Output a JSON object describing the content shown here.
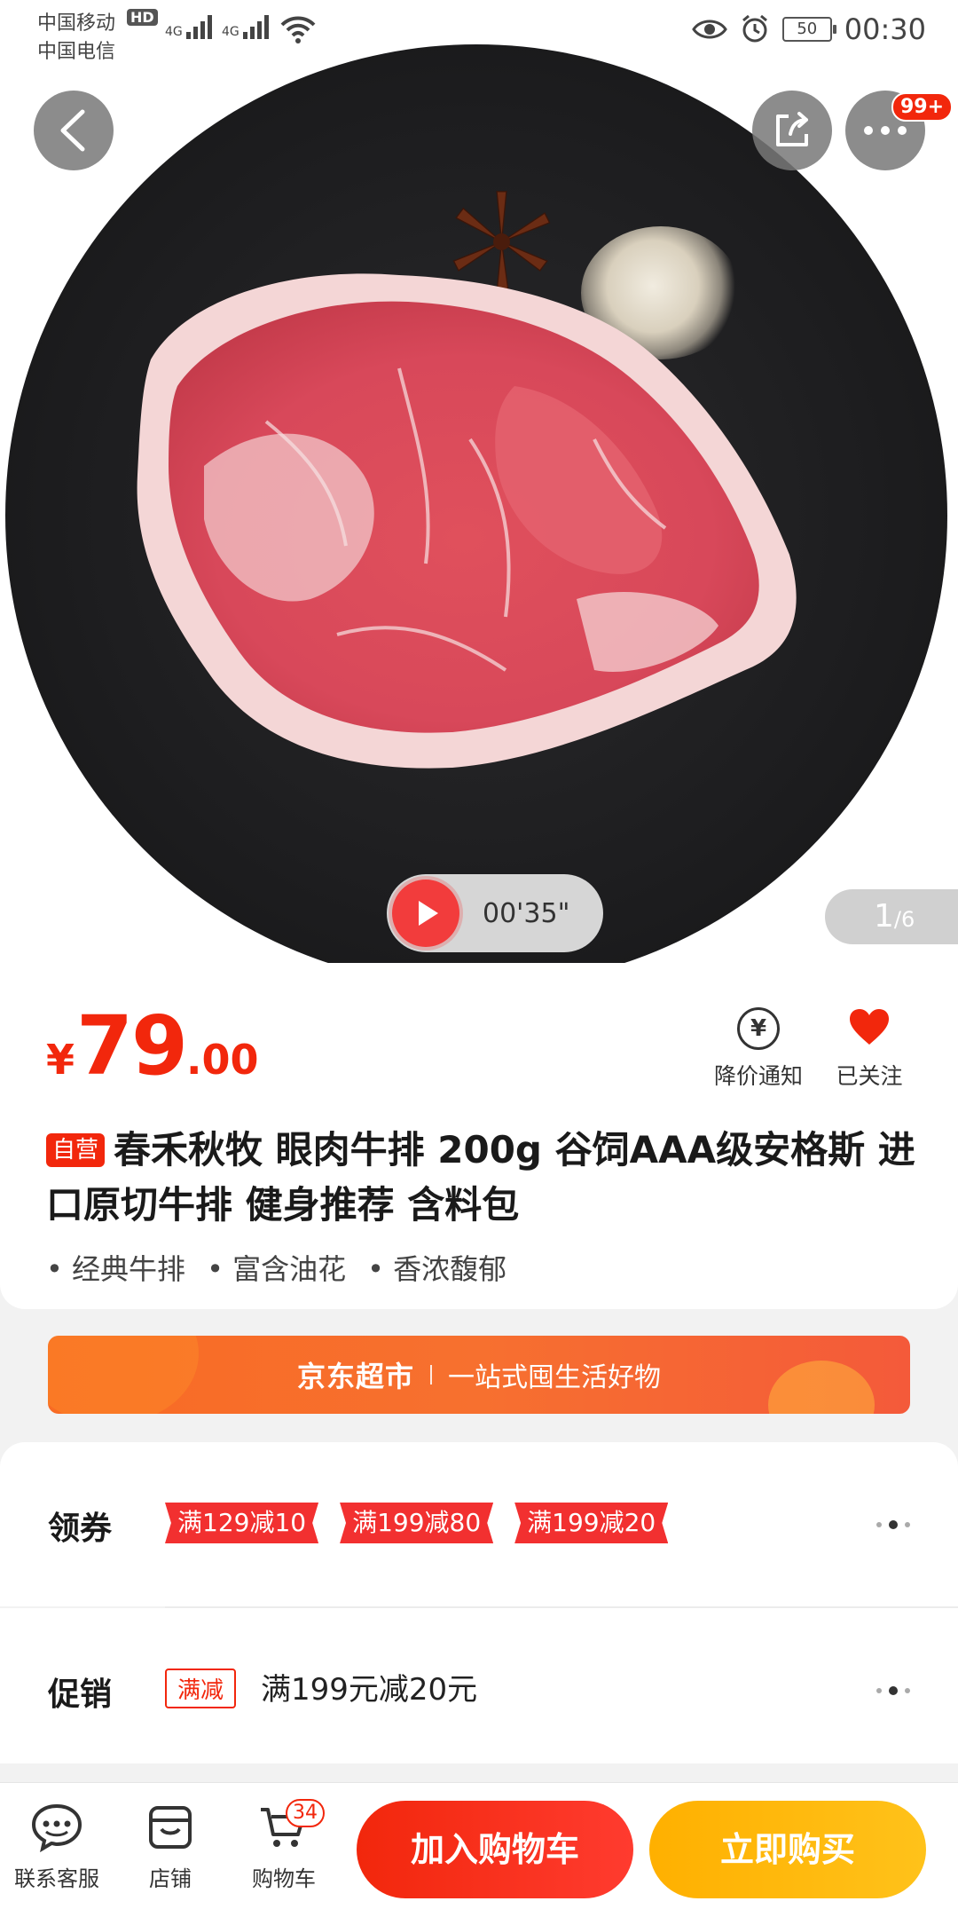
{
  "status_bar": {
    "carrier_1": "中国移动",
    "carrier_2": "中国电信",
    "hd_label": "HD",
    "net_1": "4G",
    "net_2": "4G",
    "battery": "50",
    "time": "00:30"
  },
  "header": {
    "more_badge": "99+"
  },
  "media": {
    "video_duration": "00'35\"",
    "page_current": "1",
    "page_total": "/6"
  },
  "product": {
    "currency": "¥",
    "price_int": "79",
    "price_dec": ".00",
    "price_notify_label": "降价通知",
    "follow_label": "已关注",
    "self_operated_tag": "自营",
    "title": "春禾秋牧 眼肉牛排 200g 谷饲AAA级安格斯 进口原切牛排 健身推荐 含料包",
    "features": [
      "经典牛排",
      "富含油花",
      "香浓馥郁"
    ]
  },
  "banner": {
    "brand": "京东超市",
    "slogan": "一站式囤生活好物"
  },
  "coupons": {
    "label": "领券",
    "items": [
      "满129减10",
      "满199减80",
      "满199减20"
    ]
  },
  "promotion": {
    "label": "促销",
    "tag": "满减",
    "text": "满199元减20元"
  },
  "bottom_bar": {
    "service_label": "联系客服",
    "shop_label": "店铺",
    "cart_label": "购物车",
    "cart_count": "34",
    "add_to_cart": "加入购物车",
    "buy_now": "立即购买"
  },
  "colors": {
    "accent_red": "#f2270c",
    "buy_yellow": "#ffb000",
    "banner_orange": "#f86b24"
  }
}
